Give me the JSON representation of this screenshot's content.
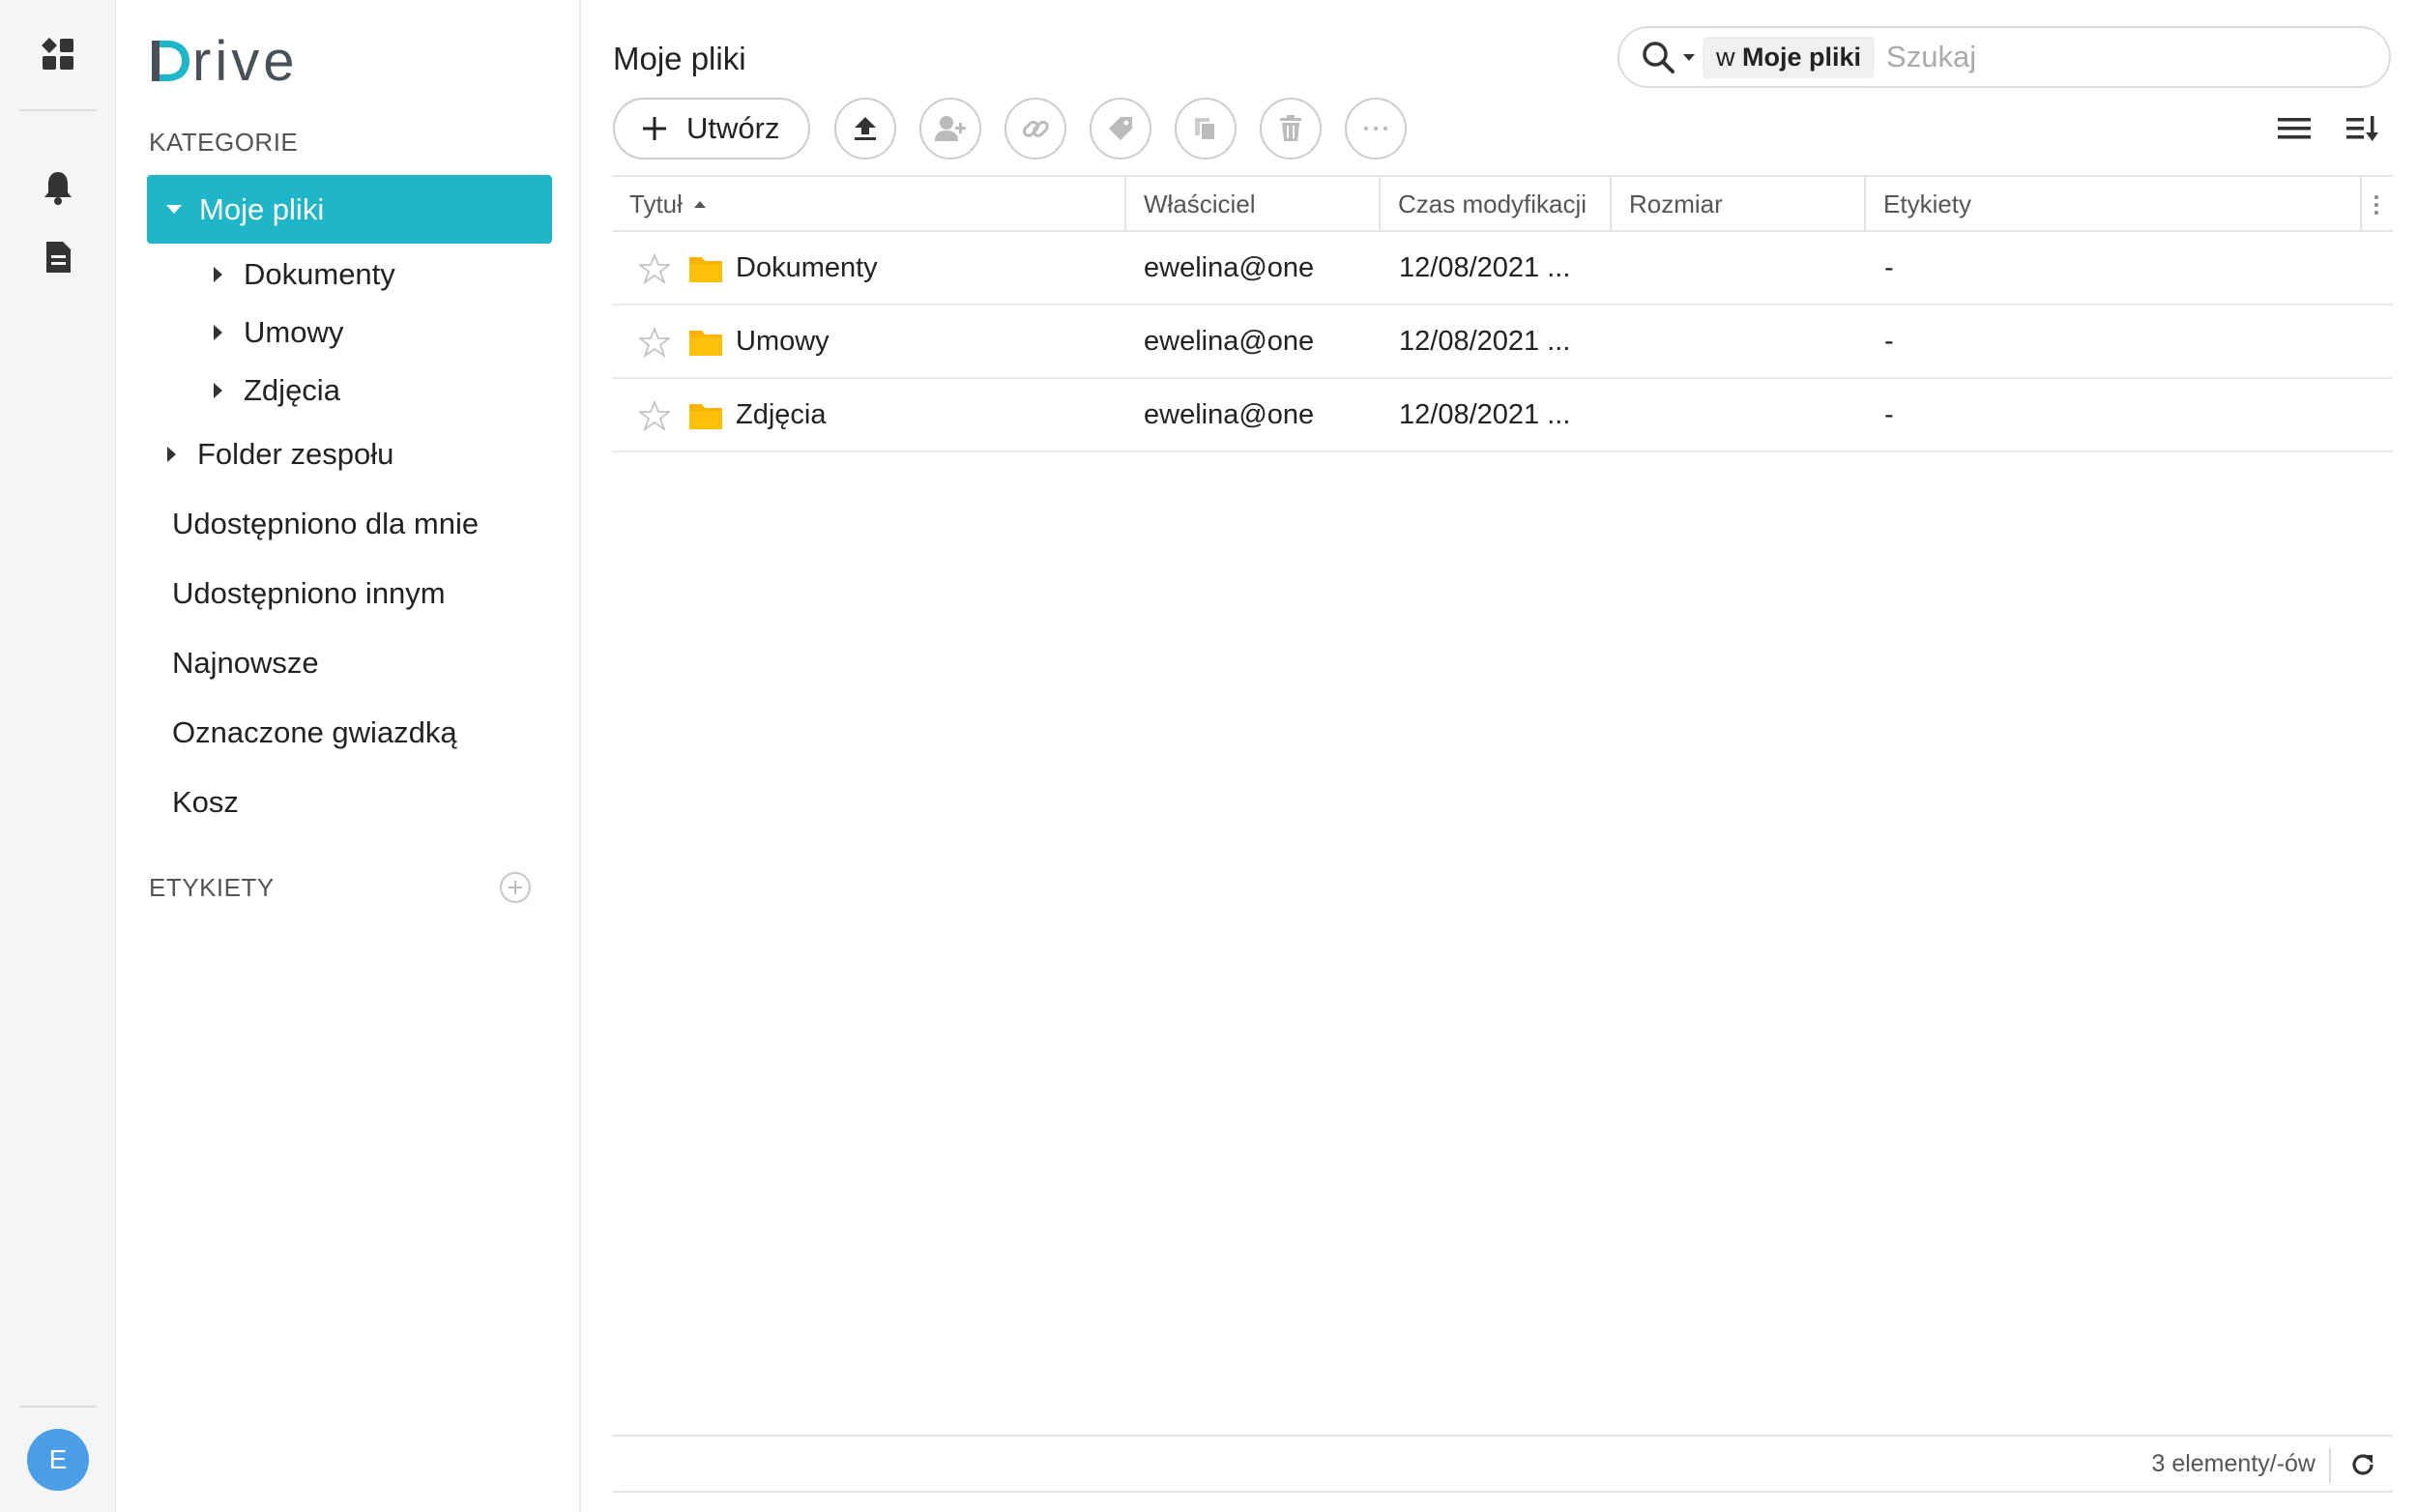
{
  "app": {
    "logo_text": "Drive"
  },
  "rail": {
    "items": [
      {
        "icon": "apps-grid-icon"
      },
      {
        "icon": "bell-icon"
      },
      {
        "icon": "document-icon"
      }
    ],
    "avatar_letter": "E"
  },
  "sidebar": {
    "categories_label": "KATEGORIE",
    "active_item": "Moje pliki",
    "subfolders": [
      "Dokumenty",
      "Umowy",
      "Zdjęcia"
    ],
    "team_folder": "Folder zespołu",
    "items": [
      "Udostępniono dla mnie",
      "Udostępniono innym",
      "Najnowsze",
      "Oznaczone gwiazdką",
      "Kosz"
    ],
    "labels_label": "ETYKIETY"
  },
  "main": {
    "title": "Moje pliki",
    "search": {
      "scope_prefix": "w",
      "scope_name": "Moje pliki",
      "placeholder": "Szukaj"
    },
    "toolbar": {
      "create_label": "Utwórz",
      "tools": [
        "upload-icon",
        "share-user-icon",
        "link-icon",
        "tag-icon",
        "copy-icon",
        "trash-icon",
        "more-icon"
      ]
    },
    "columns": [
      "Tytuł",
      "Właściciel",
      "Czas modyfikacji",
      "Rozmiar",
      "Etykiety"
    ],
    "rows": [
      {
        "title": "Dokumenty",
        "owner": "ewelina@one",
        "modified": "12/08/2021 ...",
        "size": "",
        "labels": "-"
      },
      {
        "title": "Umowy",
        "owner": "ewelina@one",
        "modified": "12/08/2021 ...",
        "size": "",
        "labels": "-"
      },
      {
        "title": "Zdjęcia",
        "owner": "ewelina@one",
        "modified": "12/08/2021 ...",
        "size": "",
        "labels": "-"
      }
    ],
    "footer_count": "3 elementy/-ów"
  },
  "colors": {
    "accent": "#1eb6c8",
    "folder": "#ffb300",
    "avatar": "#4a9ee8"
  }
}
